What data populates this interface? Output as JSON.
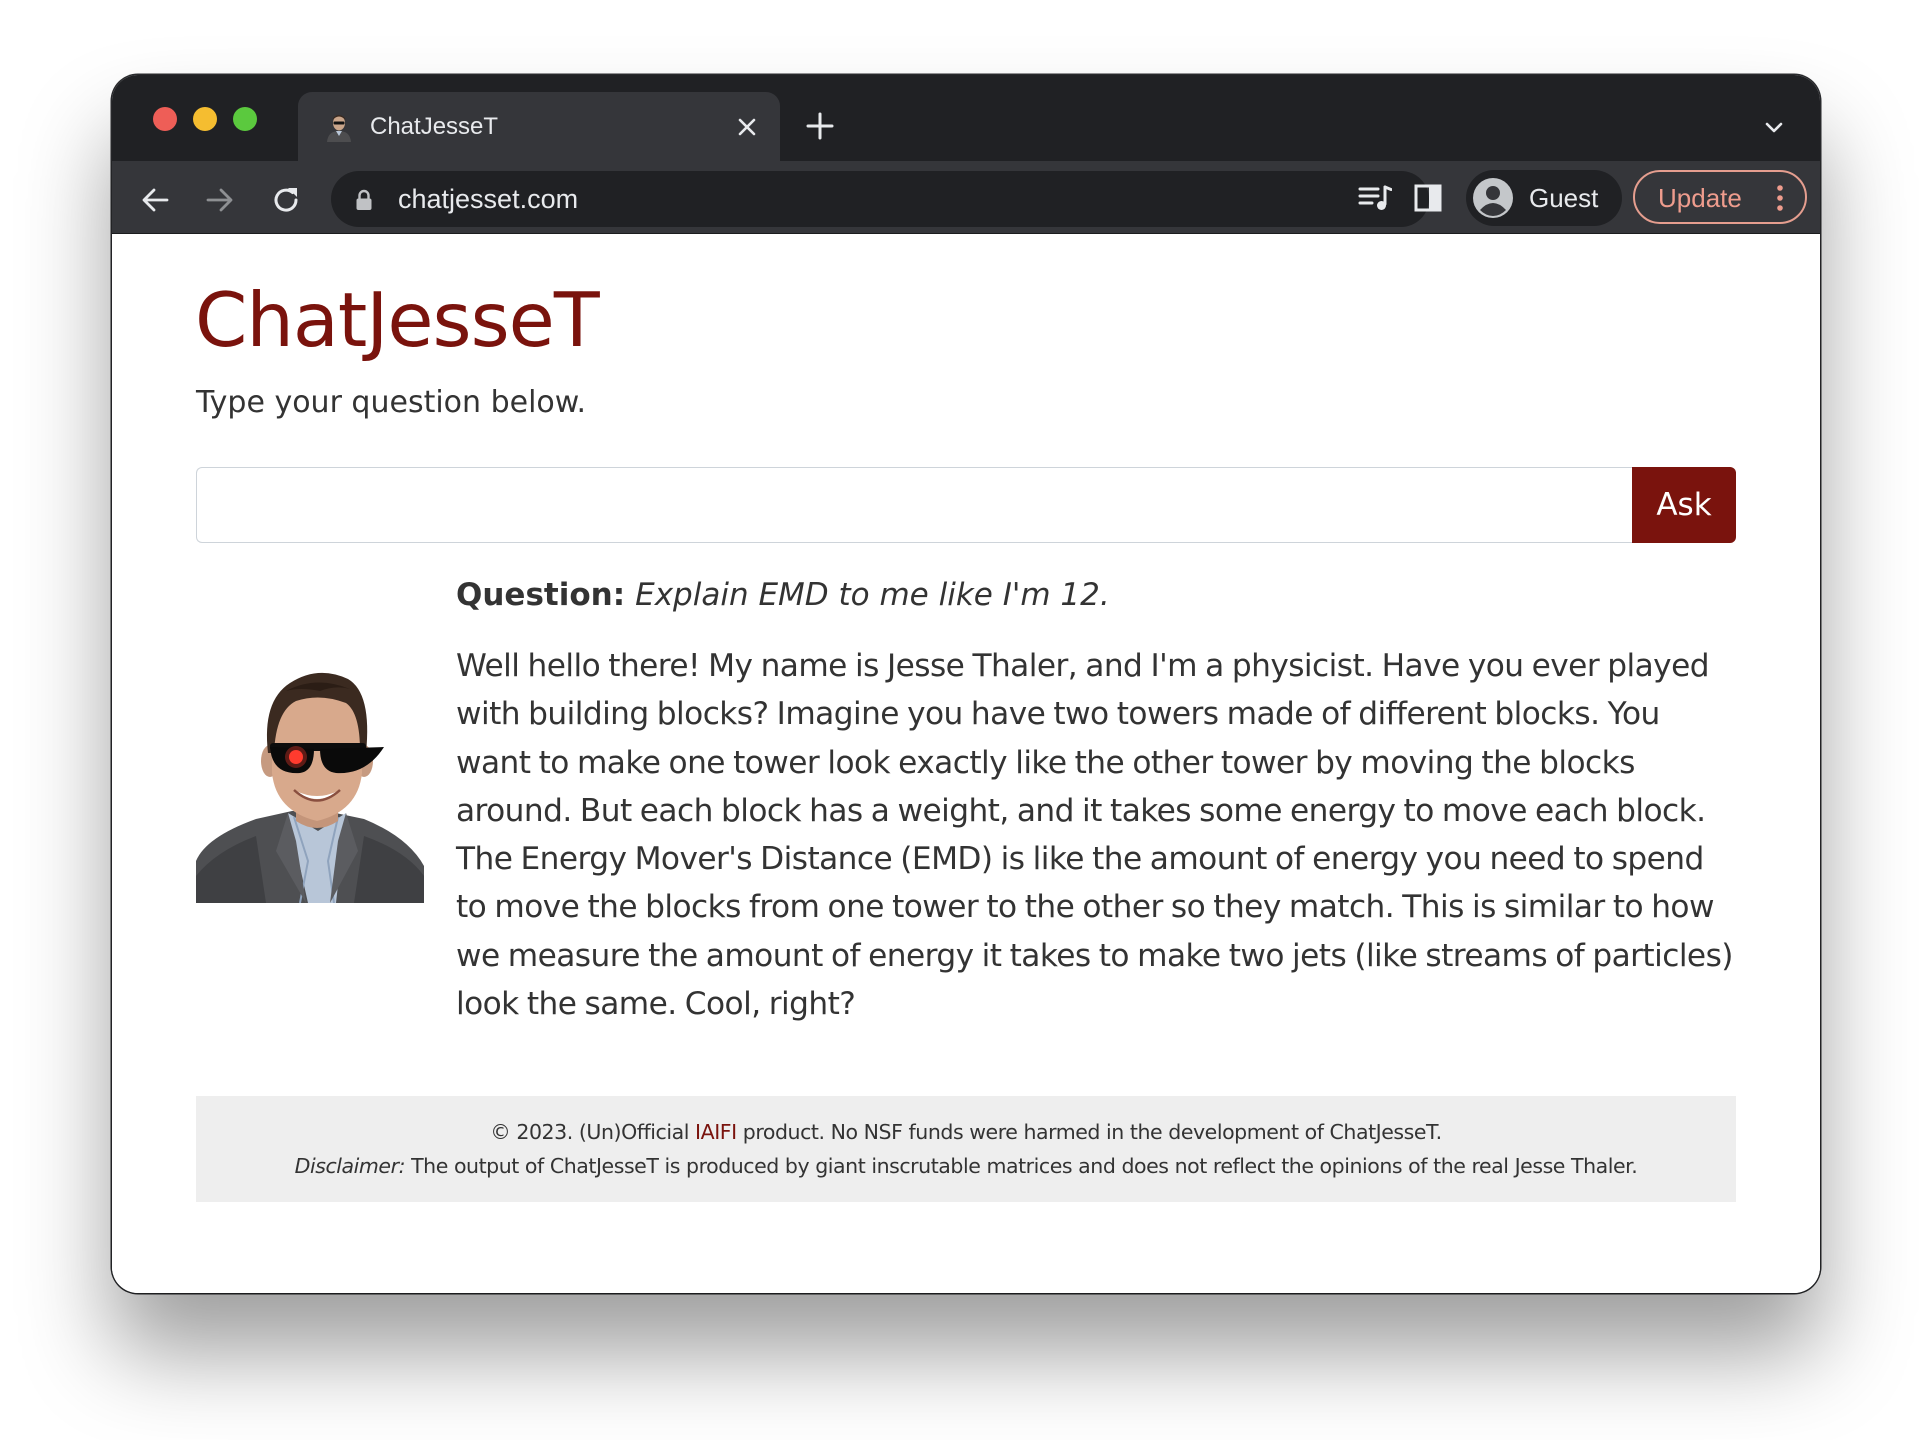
{
  "browser": {
    "tab": {
      "title": "ChatJesseT",
      "favicon": "jesse-thaler-photo"
    },
    "address_bar": {
      "url": "chatjesset.com",
      "secure_icon": "lock-icon"
    },
    "profile": {
      "label": "Guest",
      "icon": "person-circle-icon"
    },
    "update_button": {
      "label": "Update"
    },
    "icons": [
      "back-icon",
      "forward-icon",
      "reload-icon",
      "media-queue-icon",
      "side-panel-icon",
      "kebab-menu-icon",
      "close-icon",
      "plus-icon",
      "chevron-down-icon"
    ]
  },
  "page": {
    "title": "ChatJesseT",
    "instructions": "Type your question below.",
    "input": {
      "value": "",
      "placeholder": ""
    },
    "ask_button": "Ask",
    "conversation": {
      "question_label": "Question:",
      "question": "Explain EMD to me like I'm 12.",
      "answer": "Well hello there! My name is Jesse Thaler, and I'm a physicist. Have you ever played with building blocks? Imagine you have two towers made of different blocks. You want to make one tower look exactly like the other tower by moving the blocks around. But each block has a weight, and it takes some energy to move each block. The Energy Mover's Distance (EMD) is like the amount of energy you need to spend to move the blocks from one tower to the other so they match. This is similar to how we measure the amount of energy it takes to make two jets (like streams of particles) look the same. Cool, right?"
    },
    "footer": {
      "copyright_prefix": "© 2023. (Un)Official ",
      "iaifi_link": "IAIFI",
      "copyright_suffix": " product. No NSF funds were harmed in the development of ChatJesseT.",
      "disclaimer_label": "Disclaimer:",
      "disclaimer_text": " The output of ChatJesseT is produced by giant inscrutable matrices and does not reflect the opinions of the real Jesse Thaler."
    }
  },
  "colors": {
    "brand": "#7a130d",
    "chrome_dark": "#202124",
    "chrome_toolbar": "#35363a",
    "update_accent": "#ee9c8d",
    "footer_bg": "#eeeeee",
    "text": "#333333"
  }
}
